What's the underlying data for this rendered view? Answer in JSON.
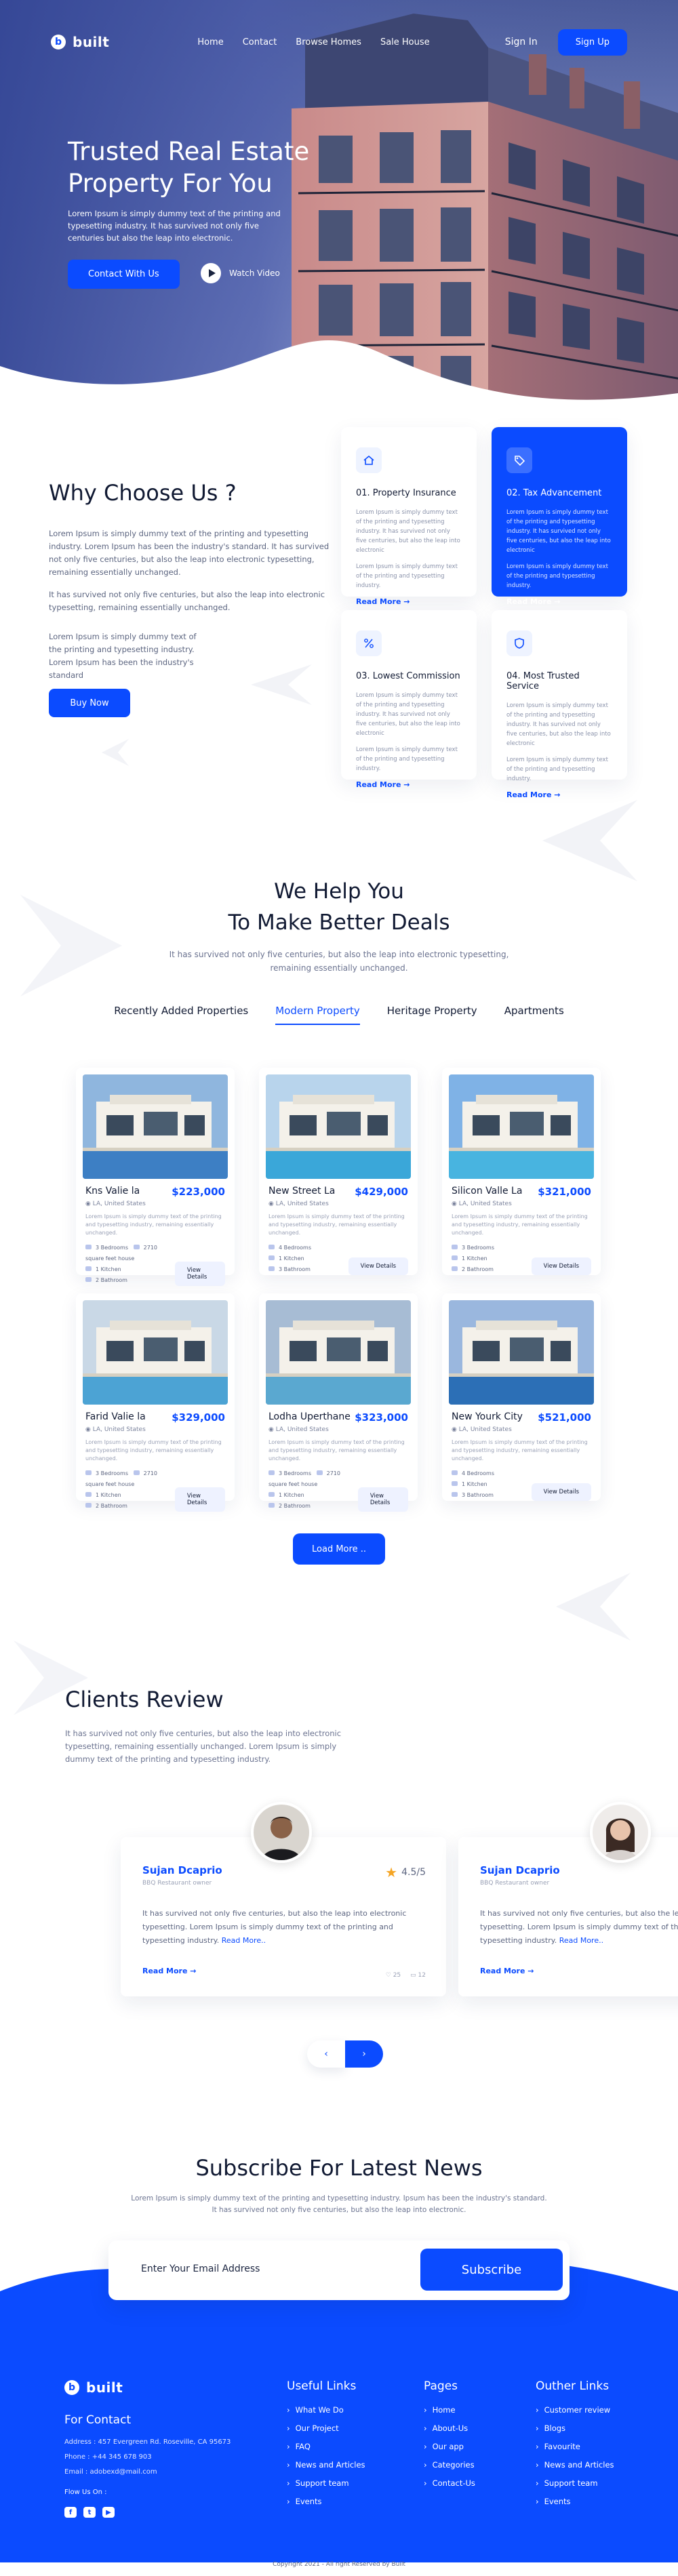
{
  "header": {
    "logo_mark": "b",
    "logo_text": "built",
    "nav": [
      "Home",
      "Contact",
      "Browse Homes",
      "Sale House"
    ],
    "sign_in": "Sign In",
    "sign_up": "Sign Up"
  },
  "hero": {
    "title": "Trusted Real Estate Property For You",
    "subtitle": "Lorem Ipsum is simply dummy text of the printing and typesetting industry. It has survived not only five centuries but also the leap into electronic.",
    "cta": "Contact With Us",
    "watch": "Watch Video"
  },
  "why": {
    "title": "Why Choose Us ?",
    "para1": "Lorem Ipsum is simply dummy text of the printing and typesetting industry. Lorem Ipsum has been the industry's standard. It has survived not only five centuries, but also the leap into electronic typesetting, remaining essentially unchanged.",
    "para2": "It has survived not only five centuries, but also the leap into electronic typesetting, remaining essentially unchanged.",
    "para3": "Lorem Ipsum is simply dummy text of the printing and typesetting industry. Lorem Ipsum has been the industry's standard",
    "button": "Buy Now",
    "cards": [
      {
        "title": "01. Property Insurance",
        "text1": "Lorem Ipsum is simply dummy text of the printing and typesetting industry. It has survived not only five centuries, but also the leap into electronic",
        "text2": "Lorem Ipsum is simply dummy text of the printing and typesetting industry.",
        "link": "Read More"
      },
      {
        "title": "02. Tax Advancement",
        "text1": "Lorem Ipsum is simply dummy text of the printing and typesetting industry. It has survived not only five centuries, but also the leap into electronic",
        "text2": "Lorem Ipsum is simply dummy text of the printing and typesetting industry.",
        "link": "Read More"
      },
      {
        "title": "03. Lowest Commission",
        "text1": "Lorem Ipsum is simply dummy text of the printing and typesetting industry. It has survived not only five centuries, but also the leap into electronic",
        "text2": "Lorem Ipsum is simply dummy text of the printing and typesetting industry.",
        "link": "Read More"
      },
      {
        "title": "04. Most Trusted Service",
        "text1": "Lorem Ipsum is simply dummy text of the printing and typesetting industry. It has survived not only five centuries, but also the leap into electronic",
        "text2": "Lorem Ipsum is simply dummy text of the printing and typesetting industry.",
        "link": "Read More"
      }
    ]
  },
  "deals": {
    "title1": "We Help You",
    "title2": "To Make Better Deals",
    "subtitle1": "It has survived not only five centuries, but also the leap into electronic typesetting,",
    "subtitle2": "remaining essentially unchanged.",
    "tabs": [
      "Recently Added Properties",
      "Modern Property",
      "Heritage Property",
      "Apartments"
    ],
    "active_tab": "Modern Property",
    "properties": [
      {
        "name": "Kns Valie la",
        "price": "$223,000",
        "location": "LA, United States",
        "desc": "Lorem Ipsum is simply dummy text of the printing and typesetting industry, remaining essentially unchanged.",
        "beds": "3 Bedrooms",
        "area": "2710 square feet house",
        "kitchen": "1 Kitchen",
        "baths": "2 Bathroom",
        "button": "View Details"
      },
      {
        "name": "New Street La",
        "price": "$429,000",
        "location": "LA, United States",
        "desc": "Lorem Ipsum is simply dummy text of the printing and typesetting industry, remaining essentially unchanged.",
        "beds": "4 Bedrooms",
        "area": "",
        "kitchen": "1 Kitchen",
        "baths": "3 Bathroom",
        "button": "View Details"
      },
      {
        "name": "Silicon Valle La",
        "price": "$321,000",
        "location": "LA, United States",
        "desc": "Lorem Ipsum is simply dummy text of the printing and typesetting industry, remaining essentially unchanged.",
        "beds": "3 Bedrooms",
        "area": "",
        "kitchen": "1 Kitchen",
        "baths": "2 Bathroom",
        "button": "View Details"
      },
      {
        "name": "Farid Valie la",
        "price": "$329,000",
        "location": "LA, United States",
        "desc": "Lorem Ipsum is simply dummy text of the printing and typesetting industry, remaining essentially unchanged.",
        "beds": "3 Bedrooms",
        "area": "2710 square feet house",
        "kitchen": "1 Kitchen",
        "baths": "2 Bathroom",
        "button": "View Details"
      },
      {
        "name": "Lodha Uperthane",
        "price": "$323,000",
        "location": "LA, United States",
        "desc": "Lorem Ipsum is simply dummy text of the printing and typesetting industry, remaining essentially unchanged.",
        "beds": "3 Bedrooms",
        "area": "2710 square feet house",
        "kitchen": "1 Kitchen",
        "baths": "2 Bathroom",
        "button": "View Details"
      },
      {
        "name": "New Yourk City",
        "price": "$521,000",
        "location": "LA, United States",
        "desc": "Lorem Ipsum is simply dummy text of the printing and typesetting industry, remaining essentially unchanged.",
        "beds": "4 Bedrooms",
        "area": "",
        "kitchen": "1 Kitchen",
        "baths": "3 Bathroom",
        "button": "View Details"
      }
    ],
    "load_more": "Load More .."
  },
  "clients": {
    "title": "Clients Review",
    "subtitle": "It has survived not only five centuries, but also the leap into electronic typesetting, remaining essentially unchanged. Lorem Ipsum is simply dummy text of the printing and typesetting industry.",
    "reviews": [
      {
        "name": "Sujan Dcaprio",
        "role": "BBQ Restaurant owner",
        "rating": "4.5/5",
        "text": "It has survived not only five centuries, but also the leap into electronic typesetting. Lorem Ipsum is simply dummy text of the printing and typesetting industry.",
        "more": "Read More..",
        "link": "Read More",
        "likes": "25",
        "comments": "12"
      },
      {
        "name": "Sujan Dcaprio",
        "role": "BBQ Restaurant owner",
        "text": "It has survived not only five centuries, but also the leap into electronic typesetting. Lorem Ipsum is simply dummy text of the printing and typesetting industry.",
        "more": "Read More..",
        "link": "Read More"
      }
    ],
    "prev": "‹",
    "next": "›"
  },
  "subscribe": {
    "title": "Subscribe For Latest News",
    "text1": "Lorem Ipsum is simply dummy text of the printing and typesetting industry. Ipsum has been the industry's standard.",
    "text2": "It has survived not only five centuries, but also the leap into electronic.",
    "placeholder": "Enter Your Email Address",
    "button": "Subscribe"
  },
  "footer": {
    "logo_text": "built",
    "contact_title": "For Contact",
    "address": "Address : 457 Evergreen Rd. Roseville, CA 95673",
    "phone": "Phone : +44 345 678 903",
    "email": "Email : adobexd@mail.com",
    "follow": "Flow Us On :",
    "useful_title": "Useful Links",
    "useful": [
      "What We Do",
      "Our Project",
      "FAQ",
      "News and Articles",
      "Support team",
      "Events"
    ],
    "pages_title": "Pages",
    "pages": [
      "Home",
      "About-Us",
      "Our app",
      "Categories",
      "Contact-Us"
    ],
    "other_title": "Outher Links",
    "other": [
      "Customer review",
      "Blogs",
      "Favourite",
      "News and Articles",
      "Support team",
      "Events"
    ],
    "copyright": "Copyright 2021 - All right Reserved by Built"
  },
  "colors": {
    "primary": "#0B4BFF",
    "dark": "#111A33",
    "muted": "#6B7390"
  }
}
